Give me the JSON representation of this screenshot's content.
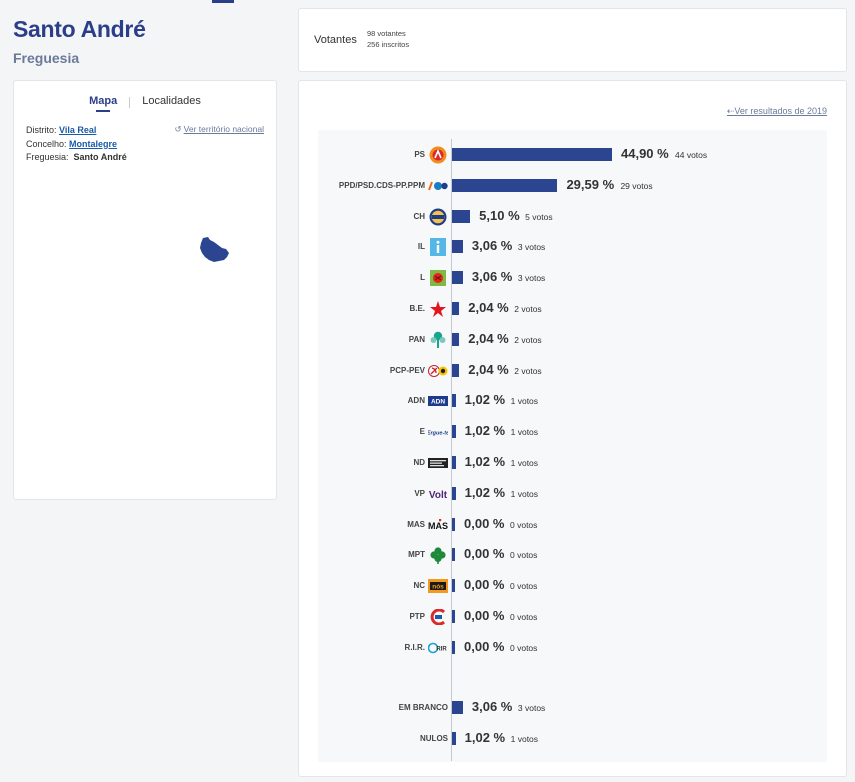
{
  "header": {
    "title": "Santo André",
    "subtitle": "Freguesia"
  },
  "tabs": {
    "map": "Mapa",
    "localities": "Localidades"
  },
  "location": {
    "distrito_label": "Distrito:",
    "distrito": "Vila Real",
    "concelho_label": "Concelho:",
    "concelho": "Montalegre",
    "freguesia_label": "Freguesia:",
    "freguesia": "Santo André",
    "back_link": "Ver território nacional"
  },
  "votantes": {
    "label": "Votantes",
    "votantes": "98 votantes",
    "inscritos": "256 inscritos"
  },
  "results": {
    "prev_link": "Ver resultados de 2019",
    "rows": [
      {
        "party": "PS",
        "pct": "44,90 %",
        "votes": "44 votos",
        "value": 44.9,
        "logo": "ps-logo"
      },
      {
        "party": "PPD/PSD.CDS-PP.PPM",
        "pct": "29,59 %",
        "votes": "29 votos",
        "value": 29.59,
        "logo": "ad-logo"
      },
      {
        "party": "CH",
        "pct": "5,10 %",
        "votes": "5 votos",
        "value": 5.1,
        "logo": "chega-logo"
      },
      {
        "party": "IL",
        "pct": "3,06 %",
        "votes": "3 votos",
        "value": 3.06,
        "logo": "il-logo"
      },
      {
        "party": "L",
        "pct": "3,06 %",
        "votes": "3 votos",
        "value": 3.06,
        "logo": "livre-logo"
      },
      {
        "party": "B.E.",
        "pct": "2,04 %",
        "votes": "2 votos",
        "value": 2.04,
        "logo": "be-logo"
      },
      {
        "party": "PAN",
        "pct": "2,04 %",
        "votes": "2 votos",
        "value": 2.04,
        "logo": "pan-logo"
      },
      {
        "party": "PCP-PEV",
        "pct": "2,04 %",
        "votes": "2 votos",
        "value": 2.04,
        "logo": "pcp-pev-logo"
      },
      {
        "party": "ADN",
        "pct": "1,02 %",
        "votes": "1 votos",
        "value": 1.02,
        "logo": "adn-logo"
      },
      {
        "party": "E",
        "pct": "1,02 %",
        "votes": "1 votos",
        "value": 1.02,
        "logo": "ergue-te-logo"
      },
      {
        "party": "ND",
        "pct": "1,02 %",
        "votes": "1 votos",
        "value": 1.02,
        "logo": "nd-logo"
      },
      {
        "party": "VP",
        "pct": "1,02 %",
        "votes": "1 votos",
        "value": 1.02,
        "logo": "volt-logo"
      },
      {
        "party": "MAS",
        "pct": "0,00 %",
        "votes": "0 votos",
        "value": 0,
        "logo": "mas-logo"
      },
      {
        "party": "MPT",
        "pct": "0,00 %",
        "votes": "0 votos",
        "value": 0,
        "logo": "mpt-logo"
      },
      {
        "party": "NC",
        "pct": "0,00 %",
        "votes": "0 votos",
        "value": 0,
        "logo": "nc-logo"
      },
      {
        "party": "PTP",
        "pct": "0,00 %",
        "votes": "0 votos",
        "value": 0,
        "logo": "ptp-logo"
      },
      {
        "party": "R.I.R.",
        "pct": "0,00 %",
        "votes": "0 votos",
        "value": 0,
        "logo": "rir-logo"
      }
    ],
    "extra": [
      {
        "party": "EM BRANCO",
        "pct": "3,06 %",
        "votes": "3 votos",
        "value": 3.06
      },
      {
        "party": "NULOS",
        "pct": "1,02 %",
        "votes": "1 votos",
        "value": 1.02
      }
    ]
  },
  "colors": {
    "accent": "#2b3e8a",
    "bar": "#2b4590",
    "link": "#1a5aa8"
  }
}
